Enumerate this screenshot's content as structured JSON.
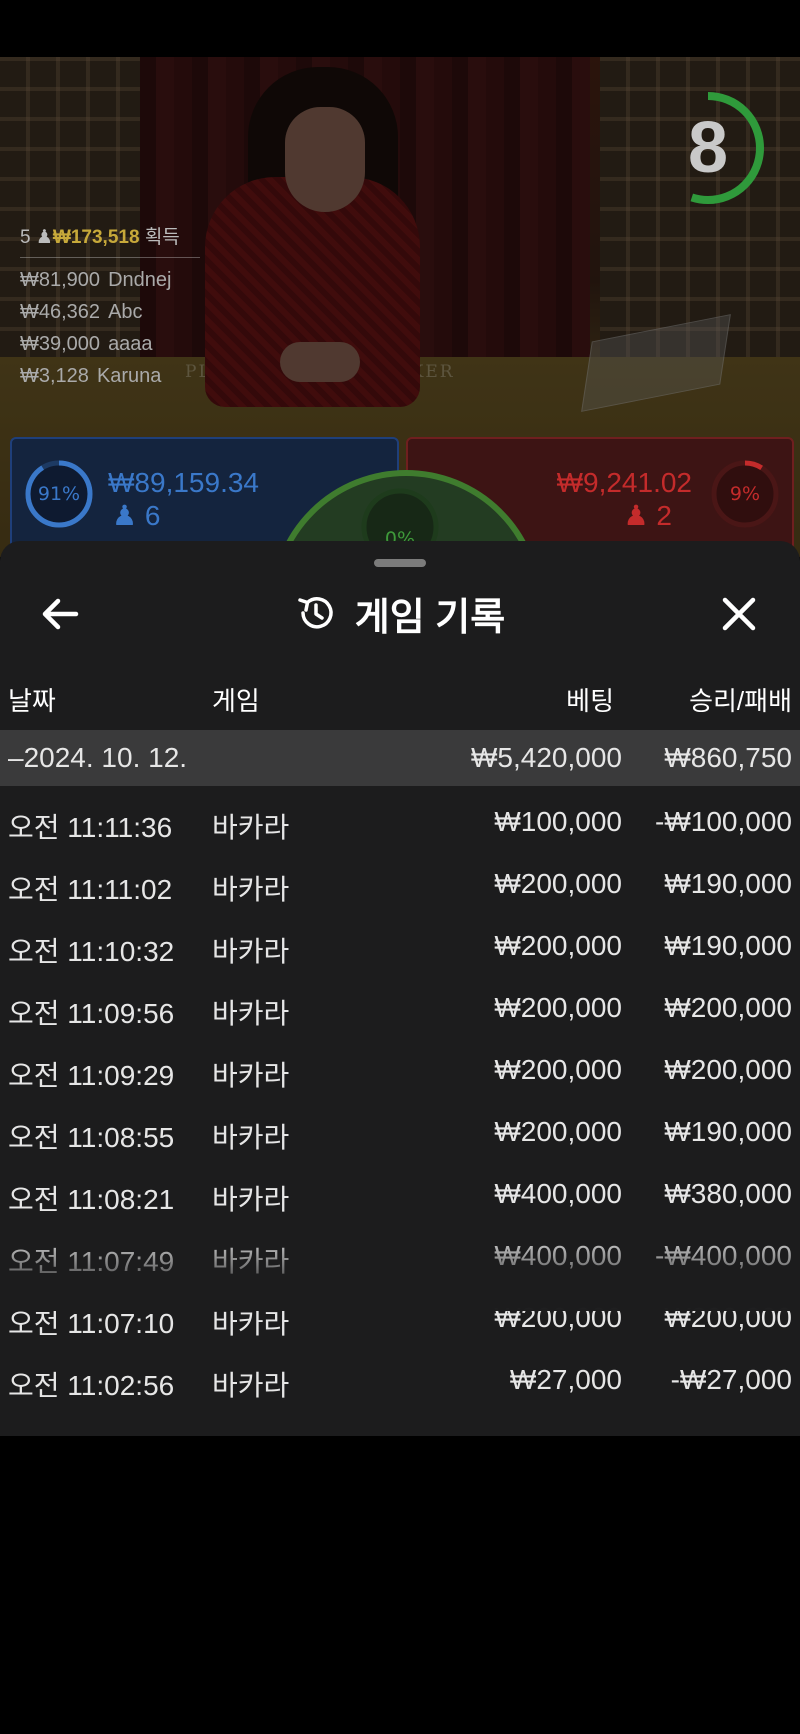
{
  "live": {
    "countdown": "8",
    "countdown_progress": 0.55,
    "table_labels": {
      "player": "PLAYER",
      "banker": "BANKER"
    },
    "winners": {
      "count": "5",
      "total": "₩173,518",
      "suffix": "획득",
      "list": [
        {
          "amount": "₩81,900",
          "name": "Dndnej"
        },
        {
          "amount": "₩46,362",
          "name": "Abc"
        },
        {
          "amount": "₩39,000",
          "name": "aaaa"
        },
        {
          "amount": "₩3,128",
          "name": "Karuna"
        }
      ]
    },
    "player": {
      "percent": "91%",
      "amount": "₩89,159.34",
      "count": "6",
      "color": "#3a78c9"
    },
    "banker": {
      "percent": "9%",
      "amount": "₩9,241.02",
      "count": "2",
      "color": "#c42b2b"
    },
    "tie": {
      "percent": "0%",
      "color": "#3e9a3a"
    }
  },
  "history": {
    "title": "게임 기록",
    "columns": {
      "date": "날짜",
      "game": "게임",
      "bet": "베팅",
      "result": "승리/패배"
    },
    "group": {
      "date": "–2024. 10. 12.",
      "bet": "₩5,420,000",
      "result": "₩860,750"
    },
    "rows": [
      {
        "time": "오전 11:11:36",
        "game": "바카라",
        "bet": "₩100,000",
        "result": "-₩100,000"
      },
      {
        "time": "오전 11:11:02",
        "game": "바카라",
        "bet": "₩200,000",
        "result": "₩190,000"
      },
      {
        "time": "오전 11:10:32",
        "game": "바카라",
        "bet": "₩200,000",
        "result": "₩190,000"
      },
      {
        "time": "오전 11:09:56",
        "game": "바카라",
        "bet": "₩200,000",
        "result": "₩200,000"
      },
      {
        "time": "오전 11:09:29",
        "game": "바카라",
        "bet": "₩200,000",
        "result": "₩200,000"
      },
      {
        "time": "오전 11:08:55",
        "game": "바카라",
        "bet": "₩200,000",
        "result": "₩190,000"
      },
      {
        "time": "오전 11:08:21",
        "game": "바카라",
        "bet": "₩400,000",
        "result": "₩380,000"
      },
      {
        "time": "오전 11:07:49",
        "game": "바카라",
        "bet": "₩400,000",
        "result": "-₩400,000"
      },
      {
        "time": "오전 11:07:10",
        "game": "바카라",
        "bet": "₩200,000",
        "result": "₩200,000"
      },
      {
        "time": "오전 11:02:56",
        "game": "바카라",
        "bet": "₩27,000",
        "result": "-₩27,000"
      }
    ]
  }
}
